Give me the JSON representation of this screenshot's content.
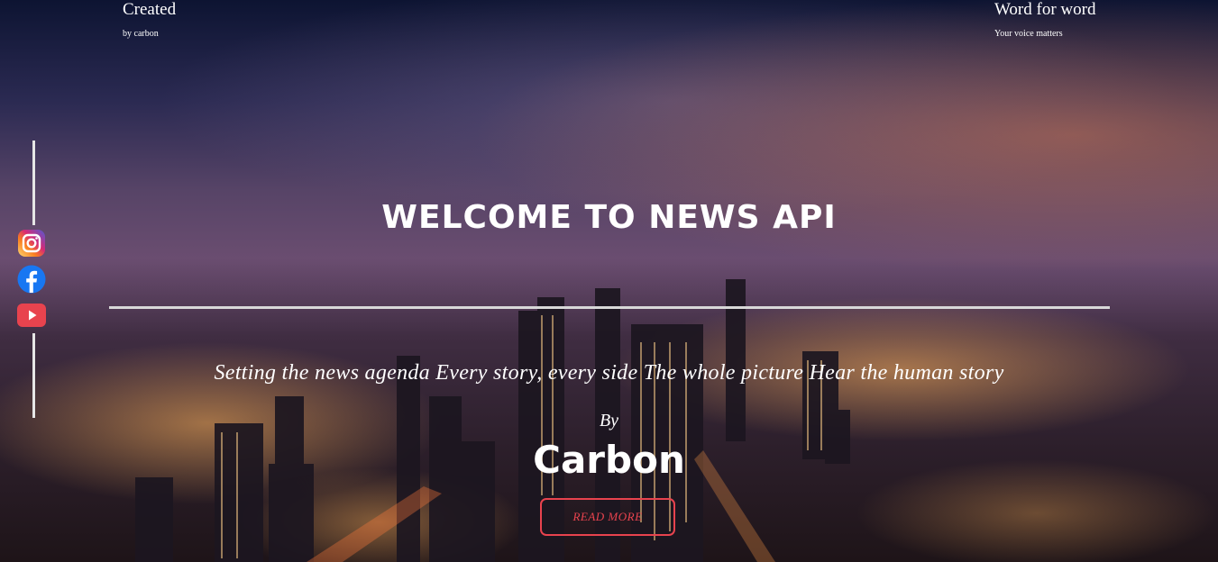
{
  "header": {
    "left": {
      "title": "Created",
      "subtitle": "by carbon"
    },
    "right": {
      "title": "Word for word",
      "subtitle": "Your voice matters"
    }
  },
  "hero": {
    "heading": "WELCOME TO NEWS API",
    "tagline": "Setting the news agenda Every story, every side The whole picture Hear the human story",
    "by": "By",
    "author": "Carbon",
    "cta": "READ MORE"
  },
  "social": [
    {
      "icon": "instagram-icon",
      "color": "#dd2a7b"
    },
    {
      "icon": "facebook-icon",
      "color": "#1877f2"
    },
    {
      "icon": "youtube-icon",
      "color": "#e8434e"
    }
  ],
  "colors": {
    "accent": "#e8434e",
    "text": "#ffffff"
  }
}
